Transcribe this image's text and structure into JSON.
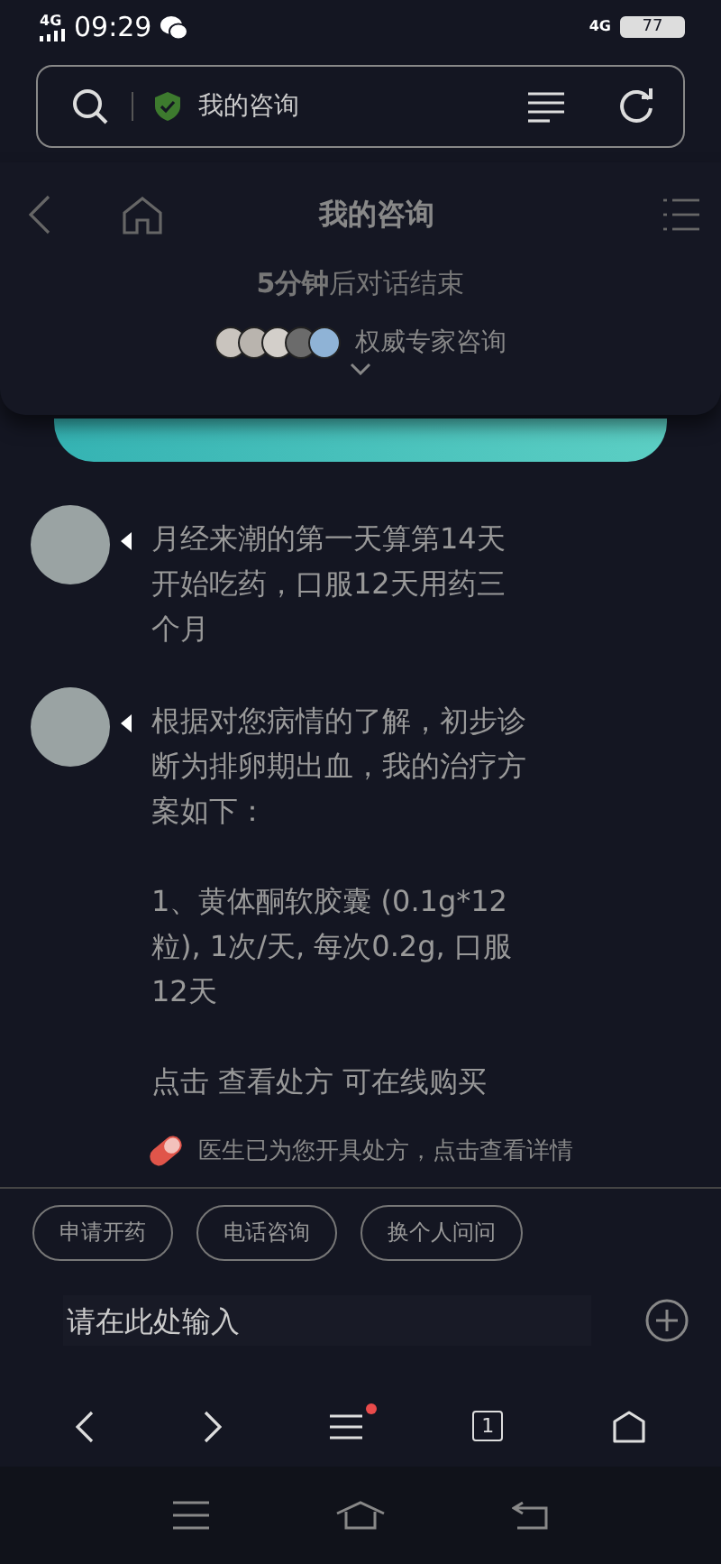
{
  "status_bar": {
    "signal_label": "4G",
    "time": "09:29",
    "network_label": "4G",
    "battery": "77"
  },
  "address_bar": {
    "title": "我的咨询"
  },
  "header": {
    "title": "我的咨询",
    "countdown": "**5分钟**后对话结束",
    "experts_label": "权威专家咨询"
  },
  "messages": [
    {
      "paragraphs": [
        "月经来潮的第一天算第14天开始吃药，口服12天用药三个月"
      ]
    },
    {
      "paragraphs": [
        "根据对您病情的了解，初步诊断为排卵期出血，我的治疗方案如下：",
        "1、黄体酮软胶囊 (0.1g*12粒), 1次/天, 每次0.2g, 口服12天",
        "点击 查看处方 可在线购买"
      ]
    }
  ],
  "notice": "医生已为您开具处方，点击查看详情",
  "quick_replies": [
    "申请开药",
    "电话咨询",
    "换个人问问"
  ],
  "input": {
    "placeholder": "请在此处输入"
  },
  "browser_bar": {
    "menu_badge": true,
    "tab_count": "1"
  }
}
